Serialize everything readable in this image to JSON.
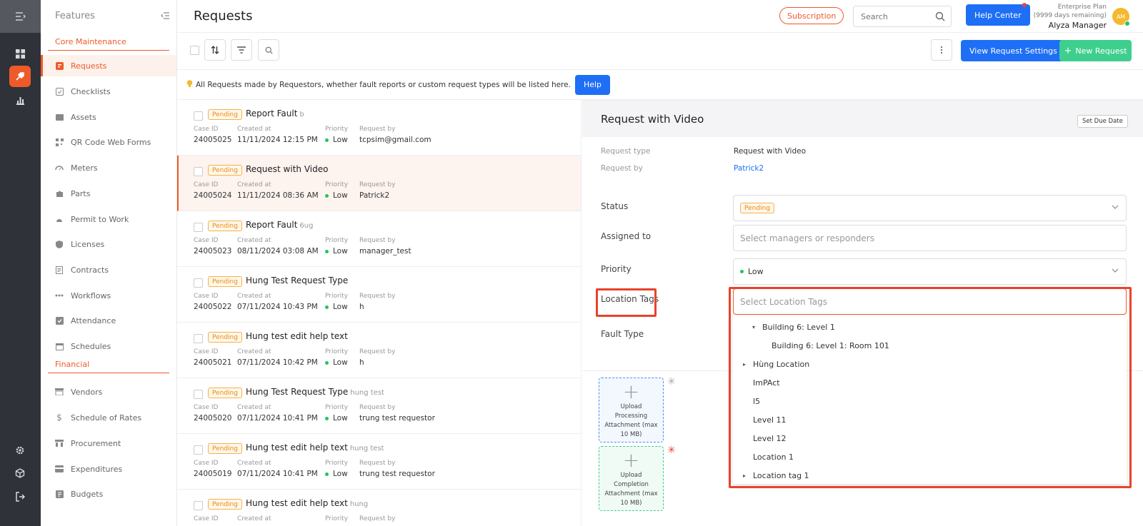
{
  "sidebar": {
    "heading": "Features",
    "sections": {
      "core": "Core Maintenance",
      "financial": "Financial"
    },
    "items": [
      {
        "label": "Requests",
        "icon": "request-icon"
      },
      {
        "label": "Checklists",
        "icon": "checklist-icon"
      },
      {
        "label": "Assets",
        "icon": "asset-icon"
      },
      {
        "label": "QR Code Web Forms",
        "icon": "qr-code-icon"
      },
      {
        "label": "Meters",
        "icon": "meter-icon"
      },
      {
        "label": "Parts",
        "icon": "puzzle-icon"
      },
      {
        "label": "Permit to Work",
        "icon": "hardhat-icon"
      },
      {
        "label": "Licenses",
        "icon": "shield-icon"
      },
      {
        "label": "Contracts",
        "icon": "contract-icon"
      },
      {
        "label": "Workflows",
        "icon": "workflow-icon"
      },
      {
        "label": "Attendance",
        "icon": "attendance-icon"
      },
      {
        "label": "Schedules",
        "icon": "calendar-icon"
      },
      {
        "label": "Vendors",
        "icon": "vendor-icon"
      },
      {
        "label": "Schedule of Rates",
        "icon": "dollar-icon"
      },
      {
        "label": "Procurement",
        "icon": "procurement-icon"
      },
      {
        "label": "Expenditures",
        "icon": "expenditure-icon"
      },
      {
        "label": "Budgets",
        "icon": "budget-icon"
      }
    ]
  },
  "header": {
    "title": "Requests",
    "subscription": "Subscription",
    "search_placeholder": "Search",
    "help_center": "Help Center",
    "plan": "Enterprise Plan",
    "plan_remaining": "(9999 days remaining)",
    "user_name": "Alyza Manager",
    "avatar_initials": "AM"
  },
  "toolbar": {
    "view_settings": "View Request Settings",
    "new_request": "New Request"
  },
  "infobar": {
    "text": "All Requests made by Requestors, whether fault reports or custom request types will be listed here.",
    "help": "Help"
  },
  "list_labels": {
    "case_id": "Case ID",
    "created_at": "Created at",
    "priority": "Priority",
    "request_by": "Request by"
  },
  "requests": [
    {
      "status": "Pending",
      "title": "Report Fault",
      "sub": "b",
      "case_id": "24005025",
      "created": "11/11/2024 12:15 PM",
      "priority": "Low",
      "by": "tcpsim@gmail.com"
    },
    {
      "status": "Pending",
      "title": "Request with Video",
      "sub": "",
      "case_id": "24005024",
      "created": "11/11/2024 08:36 AM",
      "priority": "Low",
      "by": "Patrick2"
    },
    {
      "status": "Pending",
      "title": "Report Fault",
      "sub": "6ug",
      "case_id": "24005023",
      "created": "08/11/2024 03:08 AM",
      "priority": "Low",
      "by": "manager_test"
    },
    {
      "status": "Pending",
      "title": "Hung Test Request Type",
      "sub": "",
      "case_id": "24005022",
      "created": "07/11/2024 10:43 PM",
      "priority": "Low",
      "by": "h"
    },
    {
      "status": "Pending",
      "title": "Hung test edit help text",
      "sub": "",
      "case_id": "24005021",
      "created": "07/11/2024 10:42 PM",
      "priority": "Low",
      "by": "h"
    },
    {
      "status": "Pending",
      "title": "Hung Test Request Type",
      "sub": "hung test",
      "case_id": "24005020",
      "created": "07/11/2024 10:41 PM",
      "priority": "Low",
      "by": "trung test requestor"
    },
    {
      "status": "Pending",
      "title": "Hung test edit help text",
      "sub": "hung test",
      "case_id": "24005019",
      "created": "07/11/2024 10:41 PM",
      "priority": "Low",
      "by": "trung test requestor"
    },
    {
      "status": "Pending",
      "title": "Hung test edit help text",
      "sub": "hung",
      "case_id": "",
      "created": "",
      "priority": "",
      "by": ""
    }
  ],
  "detail": {
    "title": "Request with Video",
    "set_due_date": "Set Due Date",
    "request_type_label": "Request type",
    "request_type": "Request with Video",
    "request_by_label": "Request by",
    "request_by": "Patrick2",
    "status_label": "Status",
    "status": "Pending",
    "assigned_label": "Assigned to",
    "assigned_placeholder": "Select managers or responders",
    "priority_label": "Priority",
    "priority": "Low",
    "location_label": "Location Tags",
    "location_placeholder": "Select Location Tags",
    "fault_type_label": "Fault Type",
    "upload_processing": "Upload Processing Attachment (max 10 MB)",
    "upload_completion": "Upload Completion Attachment (max 10 MB)"
  },
  "location_options": [
    {
      "label": "Building 6: Level 1",
      "expanded": true,
      "level": 1
    },
    {
      "label": "Building 6: Level 1: Room 101",
      "expanded": null,
      "level": 2
    },
    {
      "label": "Hùng Location",
      "expanded": false,
      "level": 0
    },
    {
      "label": "ImPAct",
      "expanded": null,
      "level": 0
    },
    {
      "label": "l5",
      "expanded": null,
      "level": 0
    },
    {
      "label": "Level 11",
      "expanded": null,
      "level": 0
    },
    {
      "label": "Level 12",
      "expanded": null,
      "level": 0
    },
    {
      "label": "Location 1",
      "expanded": null,
      "level": 0
    },
    {
      "label": "Location tag 1",
      "expanded": false,
      "level": 0
    }
  ],
  "colors": {
    "accent": "#ef5a2a",
    "primary": "#1e6ff5",
    "success": "#3ecf8e",
    "rail": "#2f3238",
    "highlight": "#e8432c"
  }
}
